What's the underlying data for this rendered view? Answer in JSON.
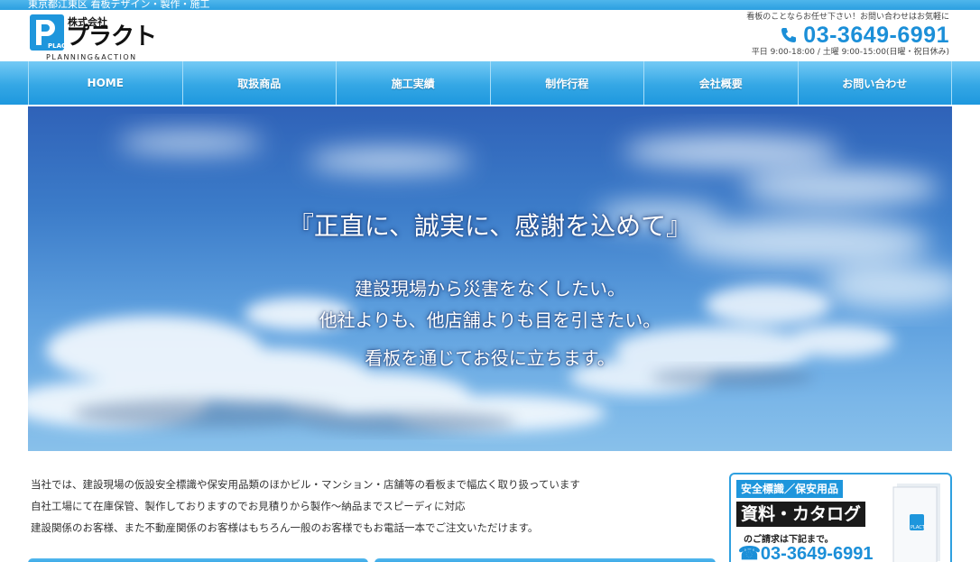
{
  "topbar": {
    "text": "東京都江東区 看板デザイン・製作・施工"
  },
  "header": {
    "logo": {
      "small": "株式会社",
      "big": "プラクト",
      "sub": "PLANNING&ACTION",
      "mark_text": "PLACT"
    },
    "note": "看板のことならお任せ下さい！お問い合わせはお気軽に",
    "phone": "03-3649-6991",
    "hours": "平日 9:00-18:00 / 土曜 9:00-15:00(日曜・祝日休み)"
  },
  "nav": {
    "items": [
      {
        "label": "HOME"
      },
      {
        "label": "取扱商品"
      },
      {
        "label": "施工実績"
      },
      {
        "label": "制作行程"
      },
      {
        "label": "会社概要"
      },
      {
        "label": "お問い合わせ"
      }
    ]
  },
  "hero": {
    "title": "『正直に、誠実に、感謝を込めて』",
    "lines": [
      "建設現場から災害をなくしたい。",
      "他社よりも、他店舗よりも目を引きたい。",
      "看板を通じてお役に立ちます。"
    ]
  },
  "intro": {
    "lines": [
      "当社では、建設現場の仮設安全標識や保安用品類のほかビル・マンション・店舗等の看板まで幅広く取り扱っています",
      "自社工場にて在庫保管、製作しておりますのでお見積りから製作～納品までスピーディに対応",
      "建設関係のお客様、また不動産関係のお客様はもちろん一般のお客様でもお電話一本でご注文いただけます。"
    ]
  },
  "catalog": {
    "tag": "安全標識／保安用品",
    "title": "資料・カタログ",
    "sub": "のご請求は下記まで。",
    "phone": "☎03-3649-6991",
    "book_mark": "PLACT"
  },
  "colors": {
    "accent": "#1b8fd8",
    "nav": "#34a7e5"
  }
}
